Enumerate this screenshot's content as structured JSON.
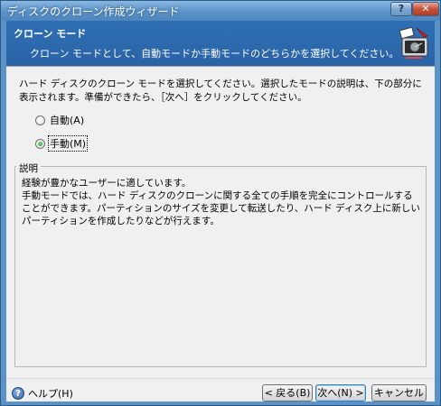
{
  "window": {
    "title": "ディスクのクローン作成ウィザード",
    "help_button": "?",
    "close_button": "✕"
  },
  "header": {
    "title": "クローン モード",
    "subtitle": "クローン モードとして、自動モードか手動モードのどちらかを選択してください。",
    "icon": "disk-clone-icon"
  },
  "intro": "ハード ディスクのクローン モードを選択してください。選択したモードの説明は、下の部分に表示されます。準備ができたら、［次へ］をクリックしてください。",
  "options": [
    {
      "label": "自動(A)",
      "checked": false
    },
    {
      "label": "手動(M)",
      "checked": true
    }
  ],
  "description": {
    "legend": "説明",
    "lines": [
      "経験が豊かなユーザーに適しています。",
      "手動モードでは、ハード ディスクのクローンに関する全ての手順を完全にコントロールすることができます。パーティションのサイズを変更して転送したり、ハード ディスク上に新しいパーティションを作成したりなどが行えます。"
    ]
  },
  "footer": {
    "help_label": "ヘルプ(H)",
    "back_label": "< 戻る(B)",
    "next_label": "次へ(N) >",
    "cancel_label": "キャンセル"
  }
}
